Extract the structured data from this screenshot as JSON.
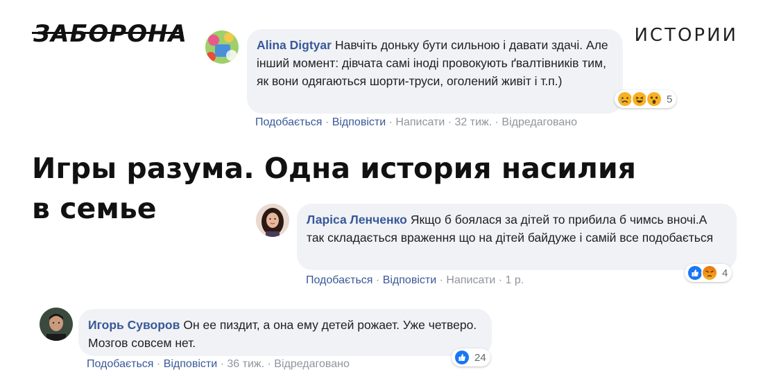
{
  "header": {
    "logo_text": "ЗАБОРОНА",
    "section_label": "ИСТОРИИ"
  },
  "headline": "Игры разума. Одна история насилия в семье",
  "separator": "·",
  "comments": [
    {
      "author": "Alina Digtyar",
      "text": "Навчіть доньку бути сильною і давати здачі. Але інший момент: дівчата самі іноді провокують ґвалтівників тим, як вони одягаються шорти-труси, оголений живіт і т.п.)",
      "reactions": [
        "sad",
        "haha",
        "wow"
      ],
      "reaction_count": "5",
      "actions": {
        "like": "Подобається",
        "reply": "Відповісти",
        "message": "Написати",
        "time": "32 тиж.",
        "edited": "Відредаговано"
      }
    },
    {
      "author": "Ларіса Ленченко",
      "text": "Якщо б боялася за дітей то прибила б чимсь вночі.А так складається враження що на дітей байдуже і самій все подобається",
      "reactions": [
        "like",
        "angry"
      ],
      "reaction_count": "4",
      "actions": {
        "like": "Подобається",
        "reply": "Відповісти",
        "message": "Написати",
        "time": "1 р."
      }
    },
    {
      "author": "Игорь Суворов",
      "text": "Он ее пиздит, а она ему детей рожает. Уже четверо. Мозгов совсем нет.",
      "reactions": [
        "like"
      ],
      "reaction_count": "24",
      "actions": {
        "like": "Подобається",
        "reply": "Відповісти",
        "time": "36 тиж.",
        "edited": "Відредаговано"
      }
    }
  ],
  "colors": {
    "author": "#385898",
    "bubble": "#f0f2f5",
    "like_blue": "#1877f2",
    "reaction_yellow": "#f7b125",
    "angry_red": "#e9710f"
  }
}
